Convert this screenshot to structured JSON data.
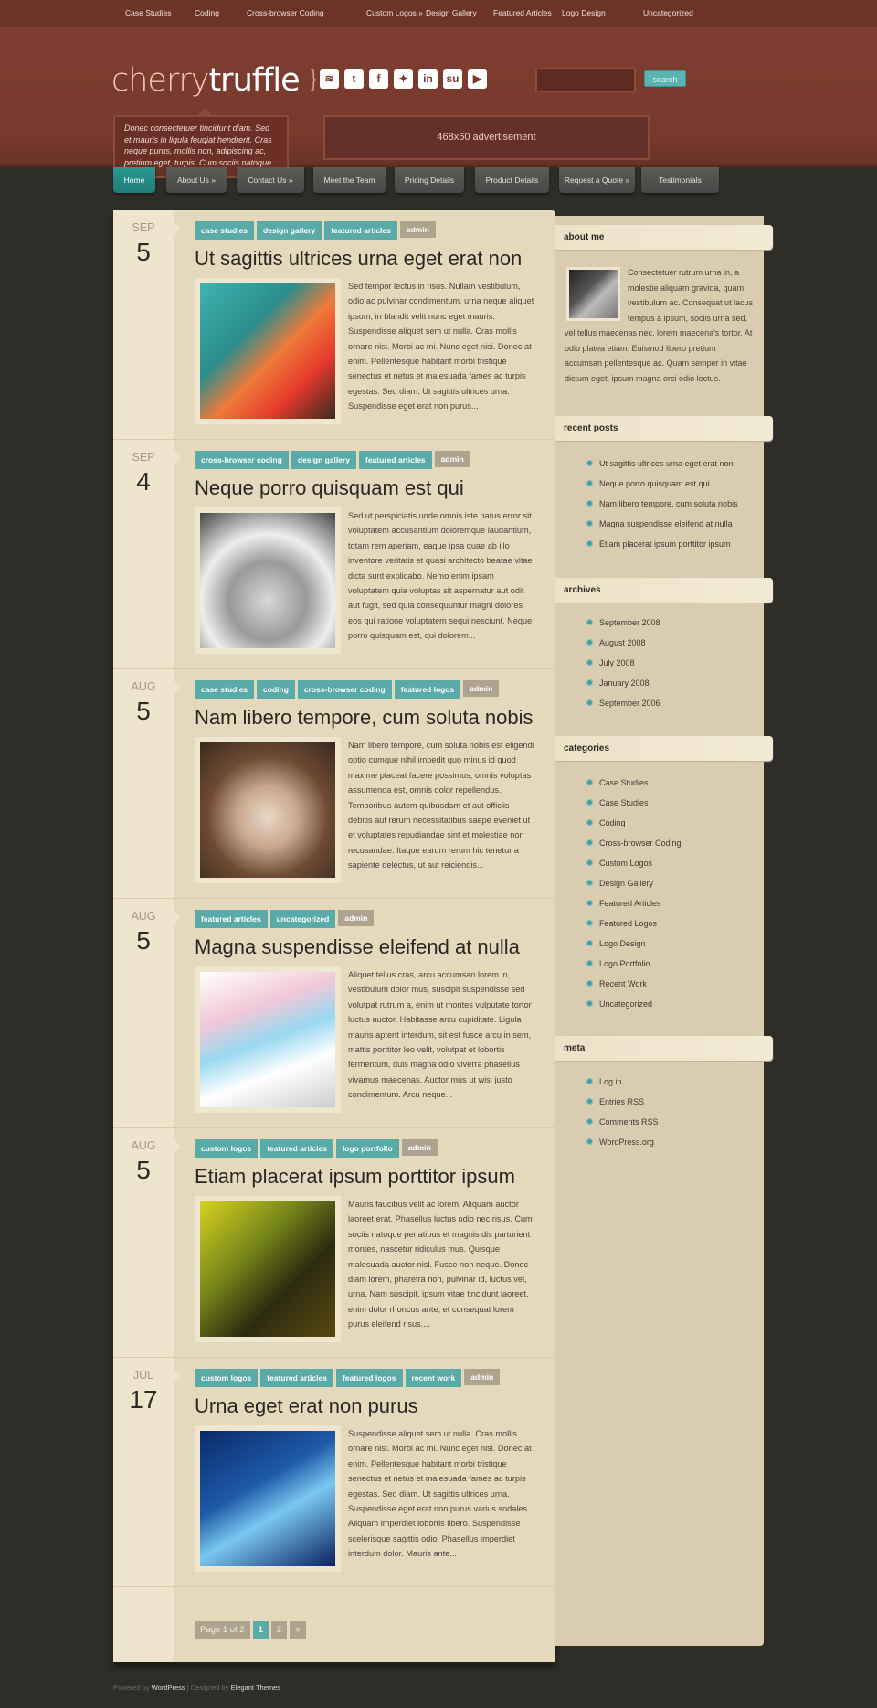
{
  "top_nav": [
    "Case Studies",
    "Coding",
    "Cross-browser Coding",
    "Custom Logos »",
    "Design Gallery",
    "Featured Articles",
    "Logo Design",
    "Uncategorized"
  ],
  "logo": {
    "part1": "cherry",
    "part2": "truffle",
    "brace": "}"
  },
  "social": [
    {
      "icon": "rss-icon",
      "glyph": "≋"
    },
    {
      "icon": "twitter-icon",
      "glyph": "t"
    },
    {
      "icon": "facebook-icon",
      "glyph": "f"
    },
    {
      "icon": "delicious-icon",
      "glyph": "✦"
    },
    {
      "icon": "linkedin-icon",
      "glyph": "in"
    },
    {
      "icon": "stumbleupon-icon",
      "glyph": "su"
    },
    {
      "icon": "youtube-icon",
      "glyph": "▶"
    }
  ],
  "search": {
    "value": "",
    "button": "search"
  },
  "tagline": "Donec consectetuer tincidunt diam. Sed et mauris in ligula feugiat hendrerit. Cras neque purus, mollis non, adipiscing ac, pretium eget, turpis. Cum sociis natoque",
  "ad": "468x60 advertisement",
  "main_nav": [
    "Home",
    "About Us »",
    "Contact Us »",
    "Meet the Team",
    "Pricing Details",
    "Product Details",
    "Request a Quote »",
    "Testimonials"
  ],
  "posts": [
    {
      "month": "SEP",
      "day": "5",
      "tags": [
        "case studies",
        "design gallery",
        "featured articles"
      ],
      "author": "admin",
      "title": "Ut sagittis ultrices urna eget erat non",
      "excerpt": "Sed tempor lectus in risus. Nullam vestibulum, odio ac pulvinar condimentum, urna neque aliquet ipsum, in blandit velit nunc eget mauris. Suspendisse aliquet sem ut nulla. Cras mollis ornare nisl. Morbi ac mi. Nunc eget nisi. Donec at enim. Pellentesque habitant morbi tristique senectus et netus et malesuada fames ac turpis egestas. Sed diam. Ut sagittis ultrices urna. Suspendisse eget erat non purus..."
    },
    {
      "month": "SEP",
      "day": "4",
      "tags": [
        "cross-browser coding",
        "design gallery",
        "featured articles"
      ],
      "author": "admin",
      "title": "Neque porro quisquam est qui",
      "excerpt": "Sed ut perspiciatis unde omnis iste natus error sit voluptatem accusantium doloremque laudantium, totam rem aperiam, eaque ipsa quae ab illo inventore veritatis et quasi architecto beatae vitae dicta sunt explicabo. Nemo enim ipsam voluptatem quia voluptas sit aspernatur aut odit aut fugit, sed quia consequuntur magni dolores eos qui ratione voluptatem sequi nesciunt. Neque porro quisquam est, qui dolorem..."
    },
    {
      "month": "AUG",
      "day": "5",
      "tags": [
        "case studies",
        "coding",
        "cross-browser coding",
        "featured logos"
      ],
      "author": "admin",
      "title": "Nam libero tempore, cum soluta nobis",
      "excerpt": "Nam libero tempore, cum soluta nobis est eligendi optio cumque nihil impedit quo minus id quod maxime placeat facere possimus, omnis voluptas assumenda est, omnis dolor repellendus. Temporibus autem quibusdam et aut officiis debitis aut rerum necessitatibus saepe eveniet ut et voluptates repudiandae sint et molestiae non recusandae. Itaque earum rerum hic tenetur a sapiente delectus, ut aut reiciendis..."
    },
    {
      "month": "AUG",
      "day": "5",
      "tags": [
        "featured articles",
        "uncategorized"
      ],
      "author": "admin",
      "title": "Magna suspendisse eleifend at nulla",
      "excerpt": "Aliquet tellus cras, arcu accumsan lorem in, vestibulum dolor mus, suscipit suspendisse sed volutpat rutrum a, enim ut montes vulputate tortor luctus auctor. Habitasse arcu cupiditate. Ligula mauris aptent interdum, sit est fusce arcu in sem, mattis porttitor leo velit, volutpat et lobortis fermentum, duis magna odio viverra phasellus vivamus maecenas. Auctor mus ut wisi justo condimentum. Arcu neque..."
    },
    {
      "month": "AUG",
      "day": "5",
      "tags": [
        "custom logos",
        "featured articles",
        "logo portfolio"
      ],
      "author": "admin",
      "title": "Etiam placerat ipsum porttitor ipsum",
      "excerpt": "Mauris faucibus velit ac lorem. Aliquam auctor laoreet erat. Phasellus luctus odio nec risus. Cum sociis natoque penatibus et magnis dis parturient montes, nascetur ridiculus mus. Quisque malesuada auctor nisl. Fusce non neque. Donec diam lorem, pharetra non, pulvinar id, luctus vel, urna. Nam suscipit, ipsum vitae tincidunt laoreet, enim dolor rhoncus ante, et consequat lorem purus eleifend risus...."
    },
    {
      "month": "JUL",
      "day": "17",
      "tags": [
        "custom logos",
        "featured articles",
        "featured logos",
        "recent work"
      ],
      "author": "admin",
      "title": "Urna eget erat non purus",
      "excerpt": "Suspendisse aliquet sem ut nulla. Cras mollis ornare nisl. Morbi ac mi. Nunc eget nisi. Donec at enim. Pellentesque habitant morbi tristique senectus et netus et malesuada fames ac turpis egestas. Sed diam. Ut sagittis ultrices urna. Suspendisse eget erat non purus varius sodales. Aliquam imperdiet lobortis libero. Suspendisse scelerisque sagittis odio. Phasellus imperdiet interdum dolor. Mauris ante..."
    }
  ],
  "pagination": {
    "info": "Page 1 of 2",
    "pages": [
      "1",
      "2"
    ],
    "current": "1",
    "next": "»"
  },
  "sidebar": {
    "about": {
      "title": "about me",
      "text": "Consectetuer rutrum urna in, a molestie aliquam gravida, quam vestibulum ac. Consequat ut lacus tempus a ipsum, sociis urna sed, vel tellus maecenas nec, lorem maecena's tortor. At odio platea etiam. Euismod libero pretium accumsan pellentesque ac. Quam semper in vitae dictum eget, ipsum magna orci odio lectus."
    },
    "recent": {
      "title": "recent posts",
      "items": [
        "Ut sagittis ultrices urna eget erat non",
        "Neque porro quisquam est qui",
        "Nam libero tempore, cum soluta nobis",
        "Magna suspendisse eleifend at nulla",
        "Etiam placerat ipsum porttitor ipsum"
      ]
    },
    "archives": {
      "title": "archives",
      "items": [
        "September 2008",
        "August 2008",
        "July 2008",
        "January 2008",
        "September 2006"
      ]
    },
    "categories": {
      "title": "categories",
      "items": [
        "Case Studies",
        "Case Studies",
        "Coding",
        "Cross-browser Coding",
        "Custom Logos",
        "Design Gallery",
        "Featured Articles",
        "Featured Logos",
        "Logo Design",
        "Logo Portfolio",
        "Recent Work",
        "Uncategorized"
      ]
    },
    "meta": {
      "title": "meta",
      "items": [
        "Log in",
        "Entries RSS",
        "Comments RSS",
        "WordPress.org"
      ]
    }
  },
  "footer": {
    "powered": "Powered by ",
    "wp": "WordPress",
    "sep": " | Designed by ",
    "et": "Elegant Themes"
  },
  "colors": {
    "accent": "#5aaba8",
    "header": "#7a3a2d",
    "content": "#e5d9bd",
    "sidebar": "#d9ccb0",
    "background": "#2f2d28"
  }
}
